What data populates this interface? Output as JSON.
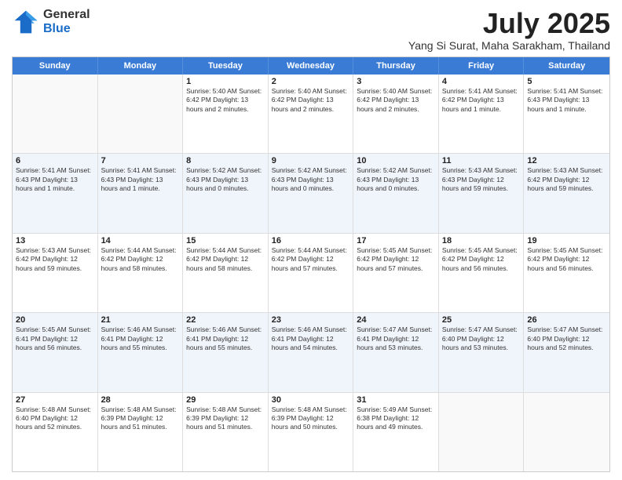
{
  "header": {
    "logo_general": "General",
    "logo_blue": "Blue",
    "month": "July 2025",
    "location": "Yang Si Surat, Maha Sarakham, Thailand"
  },
  "weekdays": [
    "Sunday",
    "Monday",
    "Tuesday",
    "Wednesday",
    "Thursday",
    "Friday",
    "Saturday"
  ],
  "rows": [
    {
      "alt": false,
      "cells": [
        {
          "day": "",
          "info": ""
        },
        {
          "day": "",
          "info": ""
        },
        {
          "day": "1",
          "info": "Sunrise: 5:40 AM\nSunset: 6:42 PM\nDaylight: 13 hours\nand 2 minutes."
        },
        {
          "day": "2",
          "info": "Sunrise: 5:40 AM\nSunset: 6:42 PM\nDaylight: 13 hours\nand 2 minutes."
        },
        {
          "day": "3",
          "info": "Sunrise: 5:40 AM\nSunset: 6:42 PM\nDaylight: 13 hours\nand 2 minutes."
        },
        {
          "day": "4",
          "info": "Sunrise: 5:41 AM\nSunset: 6:42 PM\nDaylight: 13 hours\nand 1 minute."
        },
        {
          "day": "5",
          "info": "Sunrise: 5:41 AM\nSunset: 6:43 PM\nDaylight: 13 hours\nand 1 minute."
        }
      ]
    },
    {
      "alt": true,
      "cells": [
        {
          "day": "6",
          "info": "Sunrise: 5:41 AM\nSunset: 6:43 PM\nDaylight: 13 hours\nand 1 minute."
        },
        {
          "day": "7",
          "info": "Sunrise: 5:41 AM\nSunset: 6:43 PM\nDaylight: 13 hours\nand 1 minute."
        },
        {
          "day": "8",
          "info": "Sunrise: 5:42 AM\nSunset: 6:43 PM\nDaylight: 13 hours\nand 0 minutes."
        },
        {
          "day": "9",
          "info": "Sunrise: 5:42 AM\nSunset: 6:43 PM\nDaylight: 13 hours\nand 0 minutes."
        },
        {
          "day": "10",
          "info": "Sunrise: 5:42 AM\nSunset: 6:43 PM\nDaylight: 13 hours\nand 0 minutes."
        },
        {
          "day": "11",
          "info": "Sunrise: 5:43 AM\nSunset: 6:43 PM\nDaylight: 12 hours\nand 59 minutes."
        },
        {
          "day": "12",
          "info": "Sunrise: 5:43 AM\nSunset: 6:42 PM\nDaylight: 12 hours\nand 59 minutes."
        }
      ]
    },
    {
      "alt": false,
      "cells": [
        {
          "day": "13",
          "info": "Sunrise: 5:43 AM\nSunset: 6:42 PM\nDaylight: 12 hours\nand 59 minutes."
        },
        {
          "day": "14",
          "info": "Sunrise: 5:44 AM\nSunset: 6:42 PM\nDaylight: 12 hours\nand 58 minutes."
        },
        {
          "day": "15",
          "info": "Sunrise: 5:44 AM\nSunset: 6:42 PM\nDaylight: 12 hours\nand 58 minutes."
        },
        {
          "day": "16",
          "info": "Sunrise: 5:44 AM\nSunset: 6:42 PM\nDaylight: 12 hours\nand 57 minutes."
        },
        {
          "day": "17",
          "info": "Sunrise: 5:45 AM\nSunset: 6:42 PM\nDaylight: 12 hours\nand 57 minutes."
        },
        {
          "day": "18",
          "info": "Sunrise: 5:45 AM\nSunset: 6:42 PM\nDaylight: 12 hours\nand 56 minutes."
        },
        {
          "day": "19",
          "info": "Sunrise: 5:45 AM\nSunset: 6:42 PM\nDaylight: 12 hours\nand 56 minutes."
        }
      ]
    },
    {
      "alt": true,
      "cells": [
        {
          "day": "20",
          "info": "Sunrise: 5:45 AM\nSunset: 6:41 PM\nDaylight: 12 hours\nand 56 minutes."
        },
        {
          "day": "21",
          "info": "Sunrise: 5:46 AM\nSunset: 6:41 PM\nDaylight: 12 hours\nand 55 minutes."
        },
        {
          "day": "22",
          "info": "Sunrise: 5:46 AM\nSunset: 6:41 PM\nDaylight: 12 hours\nand 55 minutes."
        },
        {
          "day": "23",
          "info": "Sunrise: 5:46 AM\nSunset: 6:41 PM\nDaylight: 12 hours\nand 54 minutes."
        },
        {
          "day": "24",
          "info": "Sunrise: 5:47 AM\nSunset: 6:41 PM\nDaylight: 12 hours\nand 53 minutes."
        },
        {
          "day": "25",
          "info": "Sunrise: 5:47 AM\nSunset: 6:40 PM\nDaylight: 12 hours\nand 53 minutes."
        },
        {
          "day": "26",
          "info": "Sunrise: 5:47 AM\nSunset: 6:40 PM\nDaylight: 12 hours\nand 52 minutes."
        }
      ]
    },
    {
      "alt": false,
      "cells": [
        {
          "day": "27",
          "info": "Sunrise: 5:48 AM\nSunset: 6:40 PM\nDaylight: 12 hours\nand 52 minutes."
        },
        {
          "day": "28",
          "info": "Sunrise: 5:48 AM\nSunset: 6:39 PM\nDaylight: 12 hours\nand 51 minutes."
        },
        {
          "day": "29",
          "info": "Sunrise: 5:48 AM\nSunset: 6:39 PM\nDaylight: 12 hours\nand 51 minutes."
        },
        {
          "day": "30",
          "info": "Sunrise: 5:48 AM\nSunset: 6:39 PM\nDaylight: 12 hours\nand 50 minutes."
        },
        {
          "day": "31",
          "info": "Sunrise: 5:49 AM\nSunset: 6:38 PM\nDaylight: 12 hours\nand 49 minutes."
        },
        {
          "day": "",
          "info": ""
        },
        {
          "day": "",
          "info": ""
        }
      ]
    }
  ]
}
